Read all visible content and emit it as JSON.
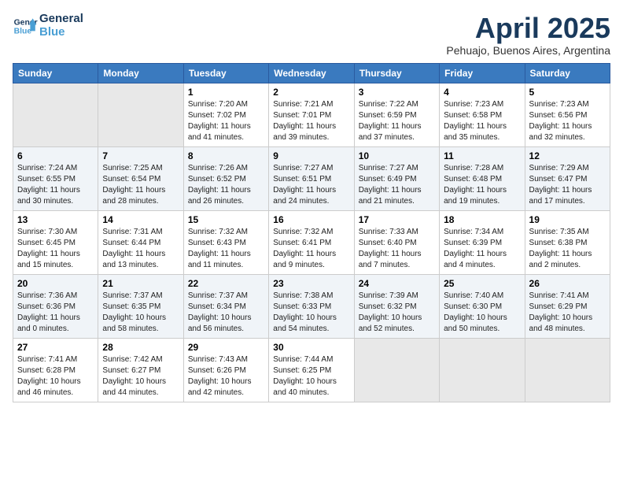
{
  "header": {
    "logo_line1": "General",
    "logo_line2": "Blue",
    "month": "April 2025",
    "location": "Pehuajo, Buenos Aires, Argentina"
  },
  "weekdays": [
    "Sunday",
    "Monday",
    "Tuesday",
    "Wednesday",
    "Thursday",
    "Friday",
    "Saturday"
  ],
  "weeks": [
    [
      {
        "day": null
      },
      {
        "day": null
      },
      {
        "day": "1",
        "sunrise": "7:20 AM",
        "sunset": "7:02 PM",
        "daylight": "11 hours and 41 minutes."
      },
      {
        "day": "2",
        "sunrise": "7:21 AM",
        "sunset": "7:01 PM",
        "daylight": "11 hours and 39 minutes."
      },
      {
        "day": "3",
        "sunrise": "7:22 AM",
        "sunset": "6:59 PM",
        "daylight": "11 hours and 37 minutes."
      },
      {
        "day": "4",
        "sunrise": "7:23 AM",
        "sunset": "6:58 PM",
        "daylight": "11 hours and 35 minutes."
      },
      {
        "day": "5",
        "sunrise": "7:23 AM",
        "sunset": "6:56 PM",
        "daylight": "11 hours and 32 minutes."
      }
    ],
    [
      {
        "day": "6",
        "sunrise": "7:24 AM",
        "sunset": "6:55 PM",
        "daylight": "11 hours and 30 minutes."
      },
      {
        "day": "7",
        "sunrise": "7:25 AM",
        "sunset": "6:54 PM",
        "daylight": "11 hours and 28 minutes."
      },
      {
        "day": "8",
        "sunrise": "7:26 AM",
        "sunset": "6:52 PM",
        "daylight": "11 hours and 26 minutes."
      },
      {
        "day": "9",
        "sunrise": "7:27 AM",
        "sunset": "6:51 PM",
        "daylight": "11 hours and 24 minutes."
      },
      {
        "day": "10",
        "sunrise": "7:27 AM",
        "sunset": "6:49 PM",
        "daylight": "11 hours and 21 minutes."
      },
      {
        "day": "11",
        "sunrise": "7:28 AM",
        "sunset": "6:48 PM",
        "daylight": "11 hours and 19 minutes."
      },
      {
        "day": "12",
        "sunrise": "7:29 AM",
        "sunset": "6:47 PM",
        "daylight": "11 hours and 17 minutes."
      }
    ],
    [
      {
        "day": "13",
        "sunrise": "7:30 AM",
        "sunset": "6:45 PM",
        "daylight": "11 hours and 15 minutes."
      },
      {
        "day": "14",
        "sunrise": "7:31 AM",
        "sunset": "6:44 PM",
        "daylight": "11 hours and 13 minutes."
      },
      {
        "day": "15",
        "sunrise": "7:32 AM",
        "sunset": "6:43 PM",
        "daylight": "11 hours and 11 minutes."
      },
      {
        "day": "16",
        "sunrise": "7:32 AM",
        "sunset": "6:41 PM",
        "daylight": "11 hours and 9 minutes."
      },
      {
        "day": "17",
        "sunrise": "7:33 AM",
        "sunset": "6:40 PM",
        "daylight": "11 hours and 7 minutes."
      },
      {
        "day": "18",
        "sunrise": "7:34 AM",
        "sunset": "6:39 PM",
        "daylight": "11 hours and 4 minutes."
      },
      {
        "day": "19",
        "sunrise": "7:35 AM",
        "sunset": "6:38 PM",
        "daylight": "11 hours and 2 minutes."
      }
    ],
    [
      {
        "day": "20",
        "sunrise": "7:36 AM",
        "sunset": "6:36 PM",
        "daylight": "11 hours and 0 minutes."
      },
      {
        "day": "21",
        "sunrise": "7:37 AM",
        "sunset": "6:35 PM",
        "daylight": "10 hours and 58 minutes."
      },
      {
        "day": "22",
        "sunrise": "7:37 AM",
        "sunset": "6:34 PM",
        "daylight": "10 hours and 56 minutes."
      },
      {
        "day": "23",
        "sunrise": "7:38 AM",
        "sunset": "6:33 PM",
        "daylight": "10 hours and 54 minutes."
      },
      {
        "day": "24",
        "sunrise": "7:39 AM",
        "sunset": "6:32 PM",
        "daylight": "10 hours and 52 minutes."
      },
      {
        "day": "25",
        "sunrise": "7:40 AM",
        "sunset": "6:30 PM",
        "daylight": "10 hours and 50 minutes."
      },
      {
        "day": "26",
        "sunrise": "7:41 AM",
        "sunset": "6:29 PM",
        "daylight": "10 hours and 48 minutes."
      }
    ],
    [
      {
        "day": "27",
        "sunrise": "7:41 AM",
        "sunset": "6:28 PM",
        "daylight": "10 hours and 46 minutes."
      },
      {
        "day": "28",
        "sunrise": "7:42 AM",
        "sunset": "6:27 PM",
        "daylight": "10 hours and 44 minutes."
      },
      {
        "day": "29",
        "sunrise": "7:43 AM",
        "sunset": "6:26 PM",
        "daylight": "10 hours and 42 minutes."
      },
      {
        "day": "30",
        "sunrise": "7:44 AM",
        "sunset": "6:25 PM",
        "daylight": "10 hours and 40 minutes."
      },
      {
        "day": null
      },
      {
        "day": null
      },
      {
        "day": null
      }
    ]
  ],
  "labels": {
    "sunrise_prefix": "Sunrise: ",
    "sunset_prefix": "Sunset: ",
    "daylight_prefix": "Daylight: "
  }
}
